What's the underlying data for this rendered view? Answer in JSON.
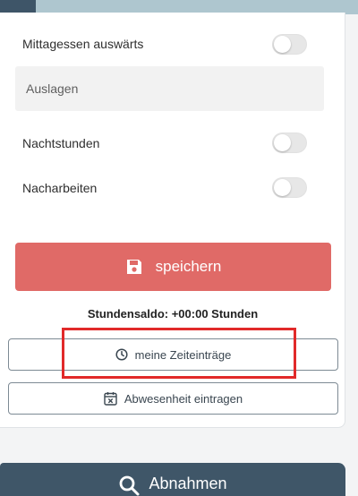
{
  "form": {
    "rows": [
      {
        "label": "Mittagessen auswärts",
        "enabled": false
      },
      {
        "label": "Nachtstunden",
        "enabled": false
      },
      {
        "label": "Nacharbeiten",
        "enabled": false
      }
    ],
    "expenses_placeholder": "Auslagen",
    "save_label": "speichern",
    "balance_text": "Stundensaldo: +00:00 Stunden",
    "my_entries_label": "meine Zeiteinträge",
    "absence_label": "Abwesenheit eintragen"
  },
  "bottom_nav": {
    "label": "Abnahmen"
  },
  "colors": {
    "save_button": "#e06a67",
    "bottom_button": "#3f5668",
    "highlight_box": "#e12a2a",
    "top_band": "#aec6cf"
  },
  "icons": [
    "save-icon",
    "clock-icon",
    "calendar-x-icon",
    "search-icon"
  ]
}
